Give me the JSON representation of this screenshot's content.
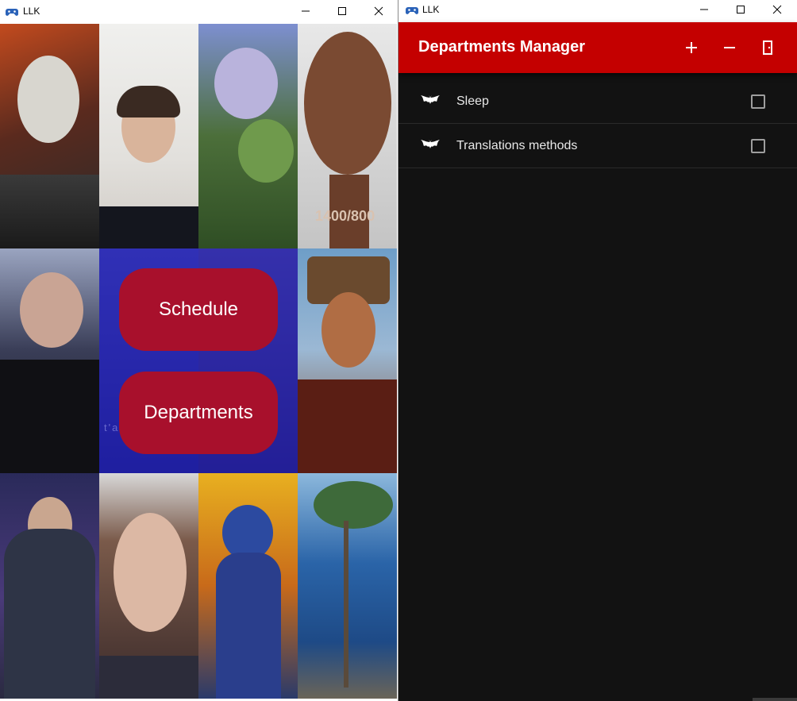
{
  "left_window": {
    "title": "LLK",
    "icon": "game-controller-icon",
    "controls": [
      "minimize-icon",
      "maximize-icon",
      "close-icon"
    ],
    "menu": {
      "schedule_label": "Schedule",
      "departments_label": "Departments"
    },
    "watermark": "t'adore.",
    "tile_watermark": "1400/800",
    "colors": {
      "button": "#a8102c",
      "overlay": "#1a1ab9"
    }
  },
  "right_window": {
    "title": "LLK",
    "icon": "game-controller-icon",
    "controls": [
      "minimize-icon",
      "maximize-icon",
      "close-icon"
    ],
    "app_bar": {
      "title": "Departments Manager",
      "actions": [
        "add-icon",
        "remove-icon",
        "exit-door-icon"
      ]
    },
    "departments": [
      {
        "name": "Sleep",
        "icon": "bat-icon",
        "checked": false
      },
      {
        "name": "Translations methods",
        "icon": "bat-icon",
        "checked": false
      }
    ],
    "colors": {
      "app_bar": "#c40000",
      "background": "#121212"
    }
  }
}
